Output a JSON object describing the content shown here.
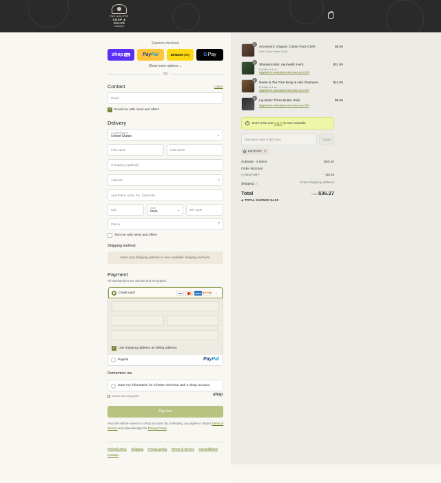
{
  "header": {
    "logo_line1": "THE HOLISTIC",
    "logo_line2": "SOAP & SALVE",
    "logo_line3": "COMPANY"
  },
  "express": {
    "title": "Express checkout",
    "shop_pay": "shop",
    "shop_pay_badge": "Pay",
    "paypal_a": "Pay",
    "paypal_b": "Pal",
    "amazon": "amazon",
    "amazon_pay": "pay",
    "gpay_g": "G",
    "gpay": "Pay",
    "show_more": "Show more options ⌄",
    "or": "OR"
  },
  "contact": {
    "heading": "Contact",
    "login": "Log in",
    "email_placeholder": "Email",
    "email_news": "Email me with news and offers"
  },
  "delivery": {
    "heading": "Delivery",
    "country_label": "Country/Region",
    "country_value": "United States",
    "first_name": "First name",
    "last_name": "Last name",
    "company": "Company (optional)",
    "address": "Address",
    "apartment": "Apartment, suite, etc. (optional)",
    "city": "City",
    "state_label": "State",
    "state_value": "Iowa",
    "zip": "ZIP code",
    "phone": "Phone",
    "text_news": "Text me with news and offers"
  },
  "shipping_method": {
    "heading": "Shipping method",
    "message": "Enter your shipping address to view available shipping methods."
  },
  "payment": {
    "heading": "Payment",
    "subtext": "All transactions are secure and encrypted.",
    "credit_card": "Credit card",
    "more_cards": "→",
    "card_visa": "VISA",
    "card_amex": "AMEX",
    "card_discover": "DISCOVER",
    "billing_same": "Use shipping address as billing address",
    "paypal": "PayPal",
    "paypal_logo_a": "Pay",
    "paypal_logo_b": "Pal"
  },
  "remember": {
    "heading": "Remember me",
    "save_info": "Save my information for a faster checkout with a Shop account",
    "secure": "Secure and encrypted",
    "shop": "shop"
  },
  "pay_now": "Pay now",
  "legal": {
    "line1": "Your info will be saved to a Shop account. By continuing, you agree to Shop's",
    "tos": "Terms of Service",
    "mid": "and acknowledge the",
    "privacy": "Privacy Policy",
    "end": "."
  },
  "footer_links": [
    "Refund policy",
    "Shipping",
    "Privacy policy",
    "Terms of service",
    "Cancellations",
    "Contact"
  ],
  "order": {
    "items": [
      {
        "title": "Accessory: Organic Cotton Face Cloth",
        "sub": "One Cotton Face Cloth",
        "upgrade": "",
        "price": "$6.50",
        "qty": "1"
      },
      {
        "title": "Shampoo Bar: Ayurvedic Herb",
        "sub": "Full Bar 4.4 oz",
        "upgrade": "Upgrade to subscription and save up to 5%",
        "price": "$11.95",
        "qty": "1"
      },
      {
        "title": "Neem & Tea Tree Body & Hair Shampoo",
        "sub": "Full Bar 4.4 oz",
        "upgrade": "Upgrade to subscription and save up to 5%",
        "price": "$11.95",
        "qty": "1"
      },
      {
        "title": "Lip Balm: Three Butter Stick",
        "sub": "",
        "upgrade": "Upgrade to subscription and save up to 5%",
        "price": "$9.90",
        "qty": "1"
      }
    ],
    "rewards_a": "Don't miss out!",
    "rewards_link": "Log in",
    "rewards_b": "to earn rewards.",
    "discount_placeholder": "Discount code or gift card",
    "apply": "Apply",
    "tag": "MILITARY",
    "subtotal_label": "Subtotal · 4 items",
    "subtotal": "$40.30",
    "order_discount": "Order discount",
    "discount_code": "MILITARY",
    "discount_value": "- $4.03",
    "shipping_label": "Shipping",
    "shipping_value": "Enter shipping address",
    "total_label": "Total",
    "currency": "USD",
    "total": "$36.27",
    "savings_label": "TOTAL SAVINGS",
    "savings": "$4.03"
  }
}
